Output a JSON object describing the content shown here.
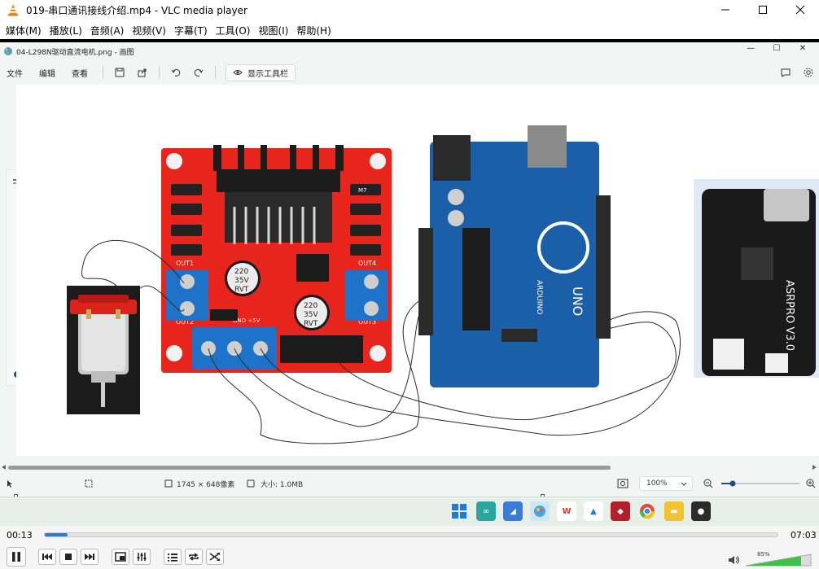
{
  "vlc": {
    "title": "019-串口通讯接线介绍.mp4 - VLC media player",
    "menu": [
      "媒体(M)",
      "播放(L)",
      "音频(A)",
      "视频(V)",
      "字幕(T)",
      "工具(O)",
      "视图(I)",
      "帮助(H)"
    ],
    "time_elapsed": "00:13",
    "time_total": "07:03",
    "progress": 0.031,
    "volume_percent": "85%",
    "volume": 0.85
  },
  "viewer": {
    "title": "04-L298N驱动直流电机.png - 画图",
    "toolbar": {
      "file": "文件",
      "edit": "编辑",
      "view": "查看",
      "show_toolbar": "显示工具栏"
    },
    "status": {
      "dimensions": "1745 × 648像素",
      "size": "大小: 1.0MB",
      "zoom": "100%"
    }
  },
  "image": {
    "l298n": {
      "cap1": "220",
      "cap1_b": "35V",
      "cap1_c": "RVT",
      "cap2": "220",
      "cap2_b": "35V",
      "cap2_c": "RVT",
      "out1": "OUT1",
      "out2": "OUT2",
      "out3": "OUT3",
      "out4": "OUT4",
      "power": "GND +5V",
      "diode": "M7"
    },
    "arduino": {
      "brand": "ARDUINO",
      "model": "UNO"
    },
    "asr": {
      "model": "ASRPRO V3.0"
    }
  },
  "taskbar": {
    "icons": [
      "windows-start-icon",
      "app-icon",
      "photos-icon",
      "paint-icon",
      "wps-icon",
      "arduino-icon",
      "app-red-icon",
      "chrome-icon",
      "explorer-icon",
      "app-dark-icon"
    ]
  },
  "colors": {
    "vlc_seek": "#2f7ad8",
    "pcb_red": "#e8251c",
    "arduino_blue": "#1a5fa8",
    "taskbar_bg": "#e6f0e8"
  }
}
